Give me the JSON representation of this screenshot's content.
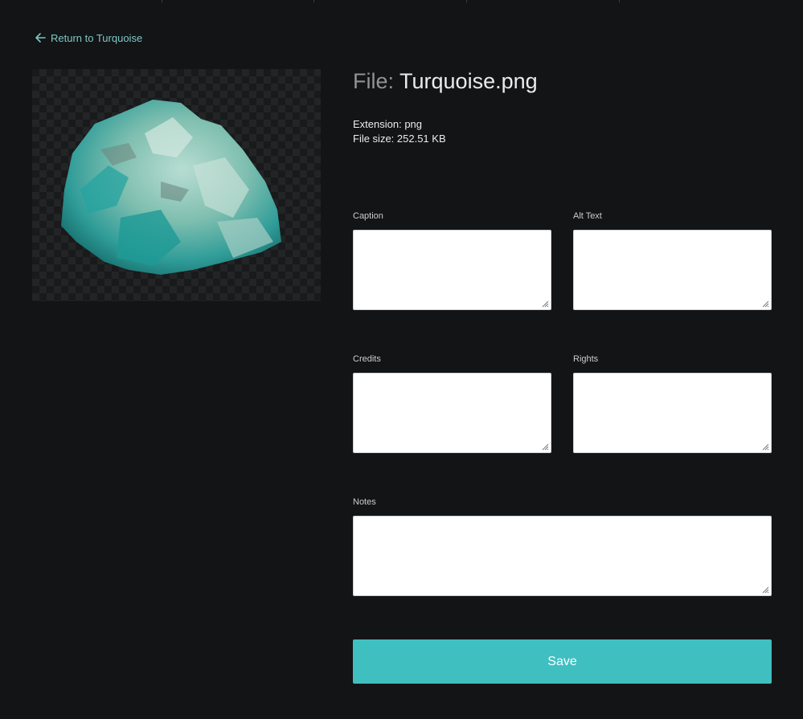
{
  "back_link": {
    "label": "Return to Turquoise",
    "icon": "arrow-left-icon"
  },
  "preview": {
    "icon": "turquoise-stone-image"
  },
  "file": {
    "title_prefix": "File:",
    "name": "Turquoise.png",
    "extension_line": "Extension: png",
    "size_line": "File size: 252.51 KB"
  },
  "fields": {
    "caption": {
      "label": "Caption",
      "value": ""
    },
    "alt_text": {
      "label": "Alt Text",
      "value": ""
    },
    "credits": {
      "label": "Credits",
      "value": ""
    },
    "rights": {
      "label": "Rights",
      "value": ""
    },
    "notes": {
      "label": "Notes",
      "value": ""
    }
  },
  "save_label": "Save",
  "colors": {
    "background": "#131415",
    "accent": "#40bfc1",
    "link": "#7ec7c7"
  }
}
